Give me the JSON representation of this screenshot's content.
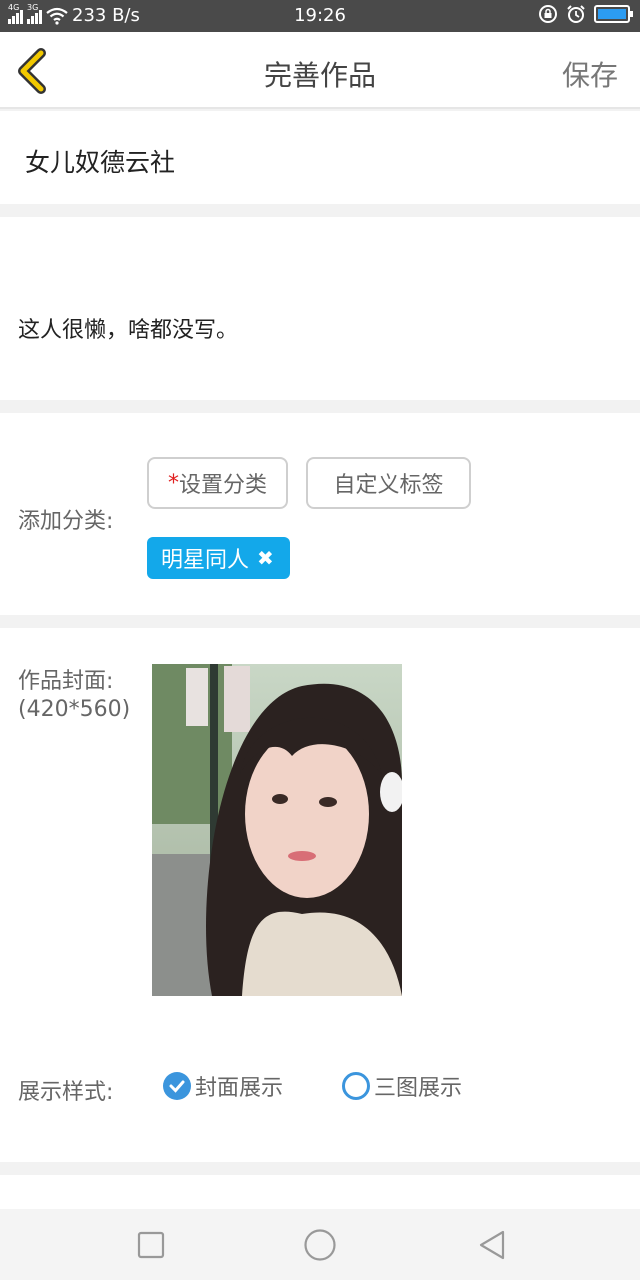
{
  "status": {
    "net_1": "4G",
    "net_2": "3G",
    "speed": "233 B/s",
    "time": "19:26"
  },
  "header": {
    "title": "完善作品",
    "save_label": "保存"
  },
  "work": {
    "title": "女儿奴德云社",
    "description": "这人很懒，啥都没写。"
  },
  "category": {
    "label": "添加分类:",
    "set_button_star": "*",
    "set_button_label": "设置分类",
    "custom_tag_label": "自定义标签",
    "selected_tag": "明星同人",
    "remove_glyph": "✖"
  },
  "cover": {
    "label_line1": "作品封面:",
    "label_line2": "(420*560)"
  },
  "display_style": {
    "label": "展示样式:",
    "options": [
      {
        "label": "封面展示",
        "selected": true
      },
      {
        "label": "三图展示",
        "selected": false
      }
    ]
  },
  "colors": {
    "accent_blue": "#13a8ea",
    "radio_blue": "#3b95dd",
    "back_arrow": "#f2c900",
    "required_star": "#e02020"
  },
  "icons": {
    "back": "back-arrow-icon",
    "nav_recent": "square-icon",
    "nav_home": "circle-icon",
    "nav_back": "triangle-back-icon"
  }
}
